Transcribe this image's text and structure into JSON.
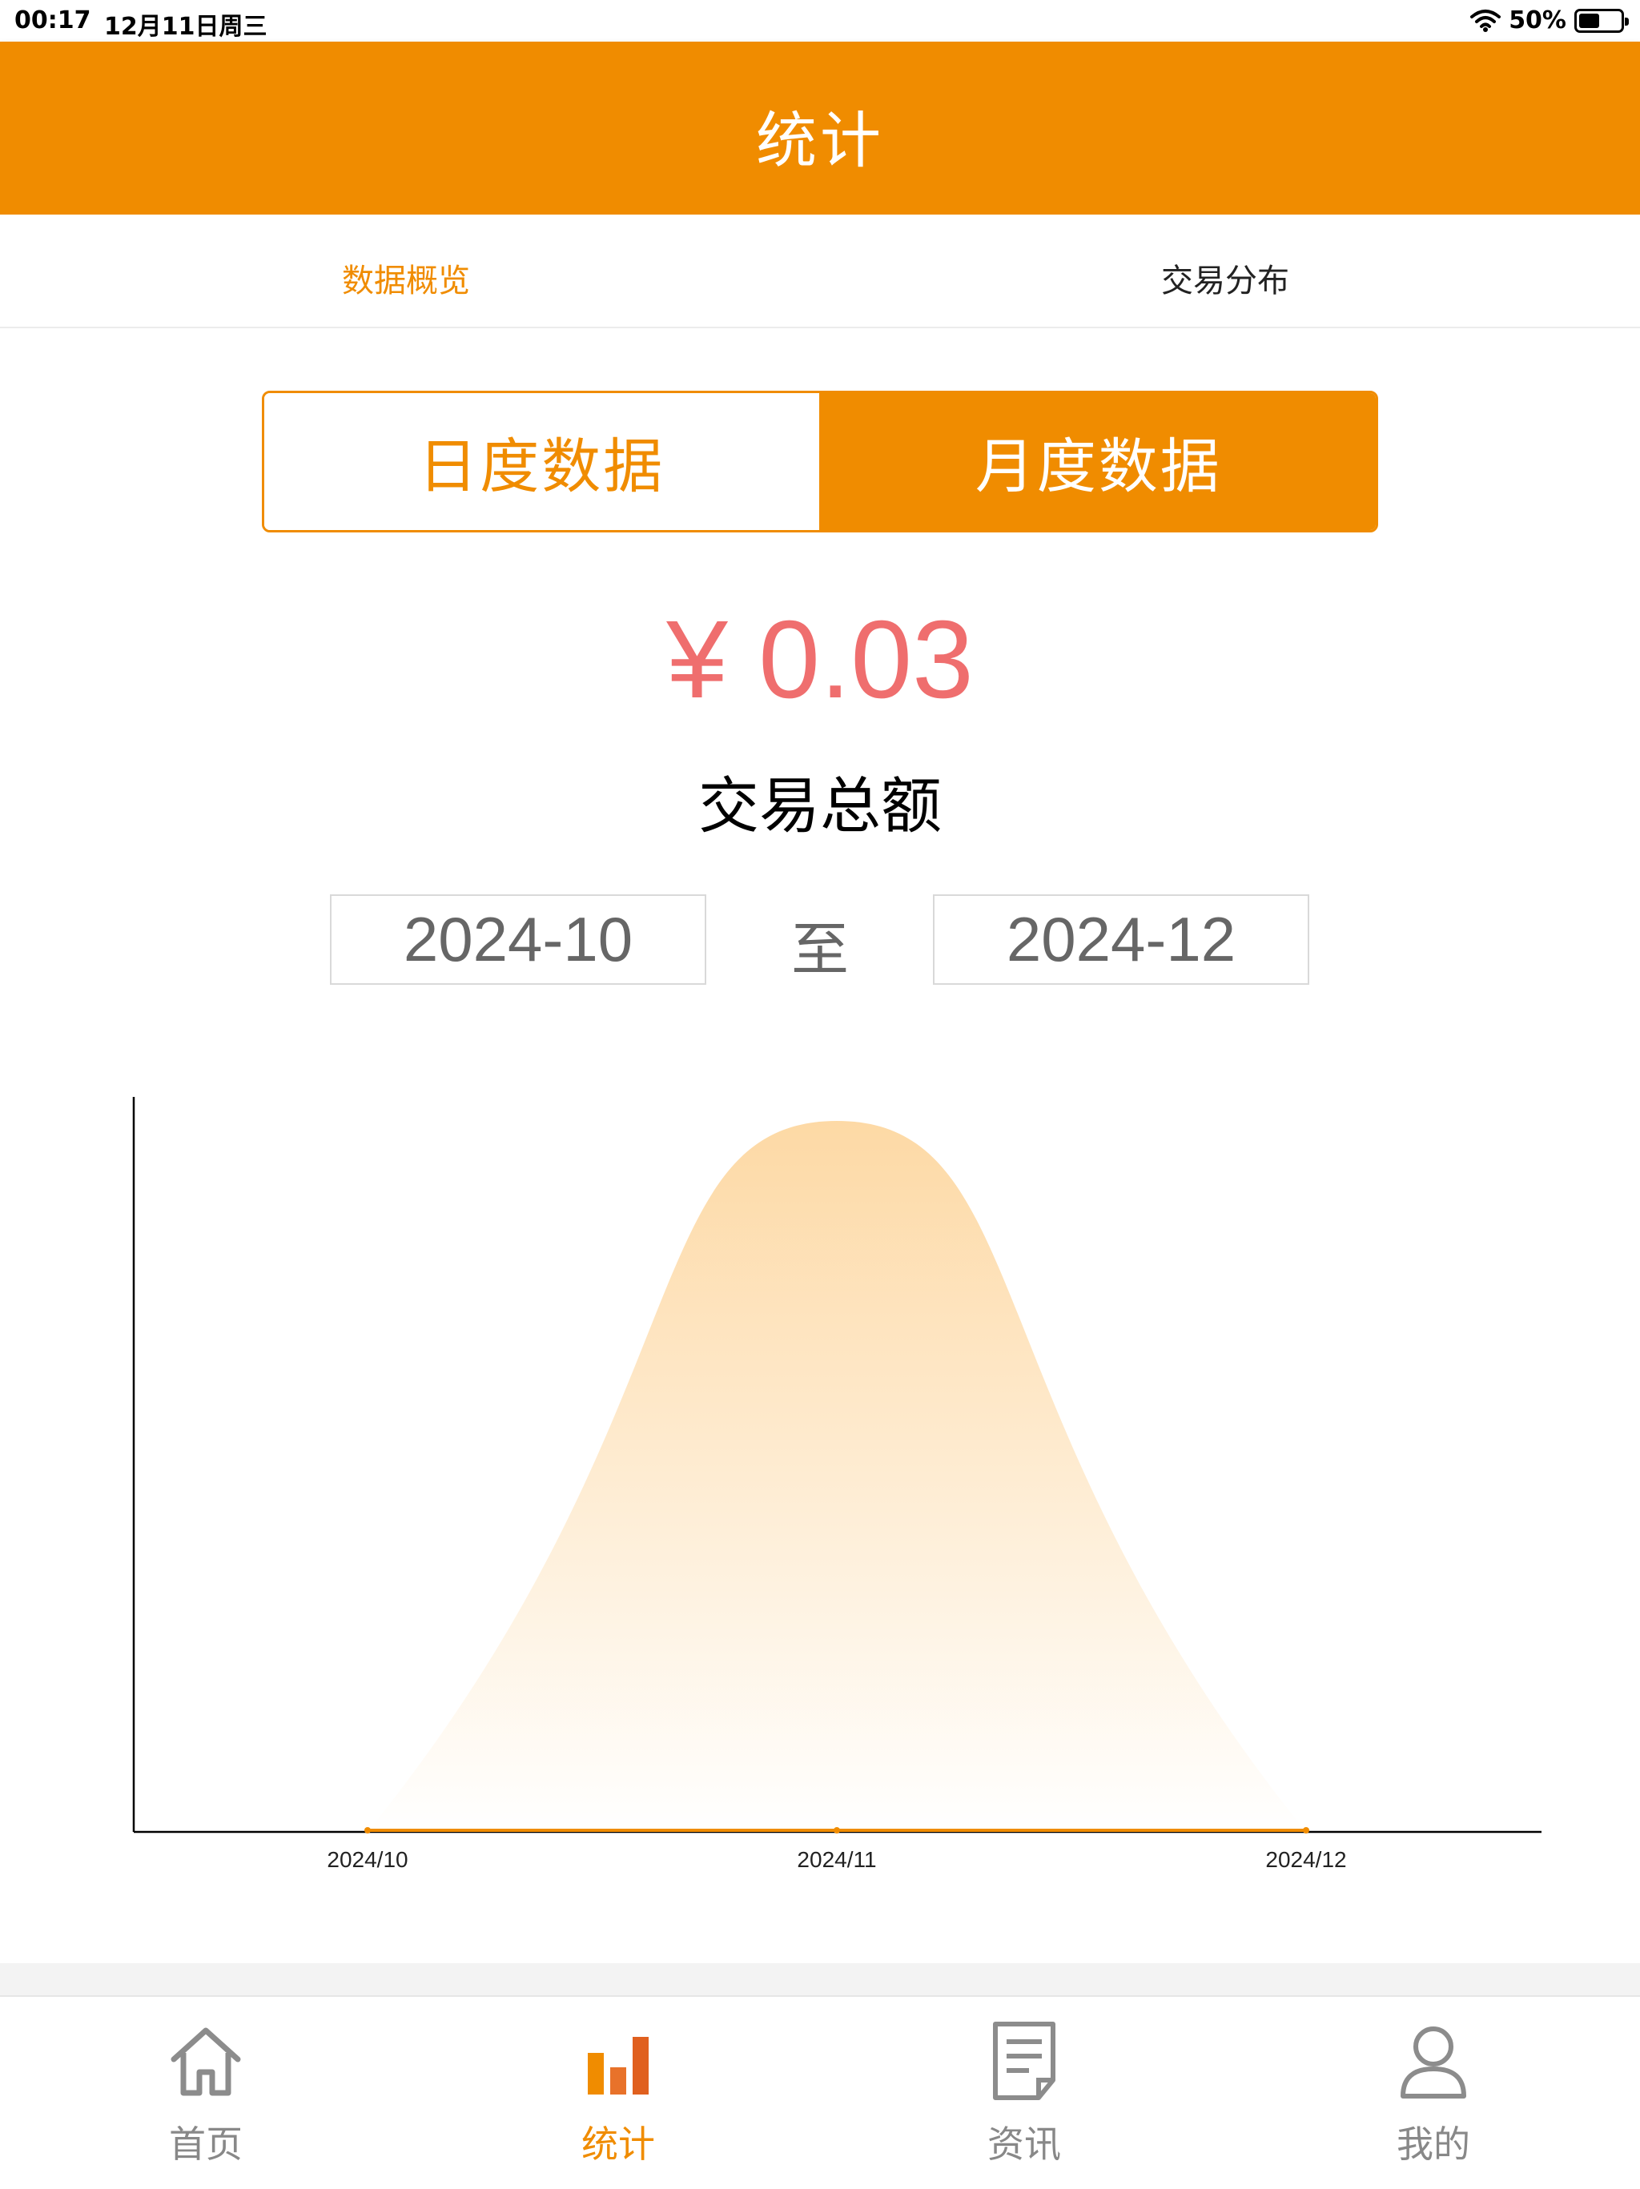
{
  "status": {
    "time": "00:17",
    "date": "12月11日周三",
    "battery": "50%",
    "battery_level": 0.5
  },
  "header": {
    "title": "统计"
  },
  "top_tabs": [
    {
      "label": "数据概览",
      "active": true
    },
    {
      "label": "交易分布",
      "active": false
    }
  ],
  "segment": {
    "left_label": "日度数据",
    "right_label": "月度数据",
    "selected": "月度数据"
  },
  "summary": {
    "amount": "¥ 0.03",
    "label": "交易总额"
  },
  "date_range": {
    "start": "2024-10",
    "separator": "至",
    "end": "2024-12"
  },
  "chart_data": {
    "type": "area",
    "categories": [
      "2024/10",
      "2024/11",
      "2024/12"
    ],
    "values": [
      0,
      0.03,
      0
    ],
    "xlabel": "",
    "ylabel": "",
    "title": "",
    "ylim": [
      0,
      0.03
    ],
    "grid": false,
    "colors": {
      "line": "#f08c00",
      "fill_top": "#fdd9a5",
      "fill_bottom": "#ffffff"
    }
  },
  "tab_bar": [
    {
      "label": "首页",
      "icon": "home-icon",
      "active": false
    },
    {
      "label": "统计",
      "icon": "bar-chart-icon",
      "active": true
    },
    {
      "label": "资讯",
      "icon": "document-icon",
      "active": false
    },
    {
      "label": "我的",
      "icon": "user-icon",
      "active": false
    }
  ],
  "colors": {
    "brand": "#f08c00",
    "amount": "#ef6e6e"
  }
}
